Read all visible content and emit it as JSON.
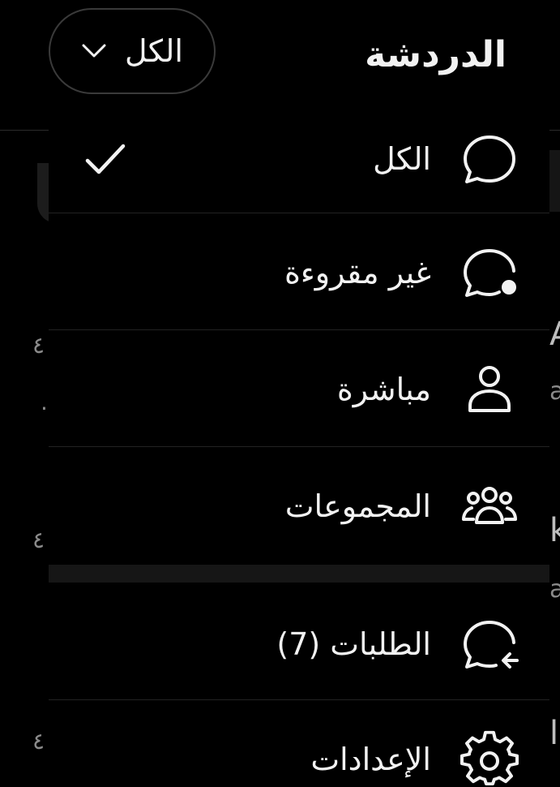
{
  "header": {
    "title": "الدردشة",
    "filter_label": "الكل"
  },
  "menu": {
    "items": [
      {
        "label": "الكل",
        "icon": "chat-bubble-icon",
        "selected": true
      },
      {
        "label": "غير مقروءة",
        "icon": "chat-unread-icon",
        "selected": false
      },
      {
        "label": "مباشرة",
        "icon": "person-icon",
        "selected": false
      },
      {
        "label": "المجموعات",
        "icon": "group-icon",
        "selected": false
      },
      {
        "label": "الطلبات (7)",
        "icon": "chat-request-icon",
        "selected": false
      },
      {
        "label": "الإعدادات",
        "icon": "gear-icon",
        "selected": false
      }
    ]
  },
  "background": {
    "times": [
      "٤",
      ".",
      "٤",
      "٤"
    ]
  },
  "colors": {
    "background": "#000000",
    "text": "#f2f2f2",
    "pill_border": "#3a3a3a",
    "separator": "#222222"
  }
}
